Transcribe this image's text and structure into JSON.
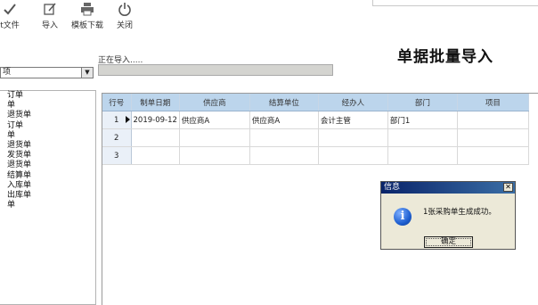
{
  "toolbar": {
    "items": [
      {
        "label": "t文件",
        "icon": "check-icon"
      },
      {
        "label": "导入",
        "icon": "edit-icon"
      },
      {
        "label": "模板下载",
        "icon": "printer-icon"
      },
      {
        "label": "关闭",
        "icon": "power-icon"
      }
    ]
  },
  "page_title": "单据批量导入",
  "status": {
    "text": "正在导入....."
  },
  "type_select": {
    "value": "项"
  },
  "doc_list": {
    "items": [
      "订单",
      "单",
      "退货单",
      "订单",
      "单",
      "退货单",
      "发货单",
      "退货单",
      "结算单",
      "入库单",
      "出库单",
      "单"
    ]
  },
  "grid": {
    "columns": [
      "行号",
      "制单日期",
      "供应商",
      "结算单位",
      "经办人",
      "部门",
      "项目"
    ],
    "rows": [
      {
        "no": "1",
        "date": "2019-09-12",
        "supplier": "供应商A",
        "settle": "供应商A",
        "handler": "会计主管",
        "dept": "部门1",
        "project": ""
      },
      {
        "no": "2",
        "date": "",
        "supplier": "",
        "settle": "",
        "handler": "",
        "dept": "",
        "project": ""
      },
      {
        "no": "3",
        "date": "",
        "supplier": "",
        "settle": "",
        "handler": "",
        "dept": "",
        "project": ""
      }
    ]
  },
  "dialog": {
    "title": "信息",
    "message": "1张采购单生成成功。",
    "ok_label": "确定",
    "icon": "info-icon"
  },
  "colors": {
    "header_blue": "#bcd5ec",
    "dialog_title": "#0a246a",
    "progress_bg": "#d4d4d0"
  }
}
